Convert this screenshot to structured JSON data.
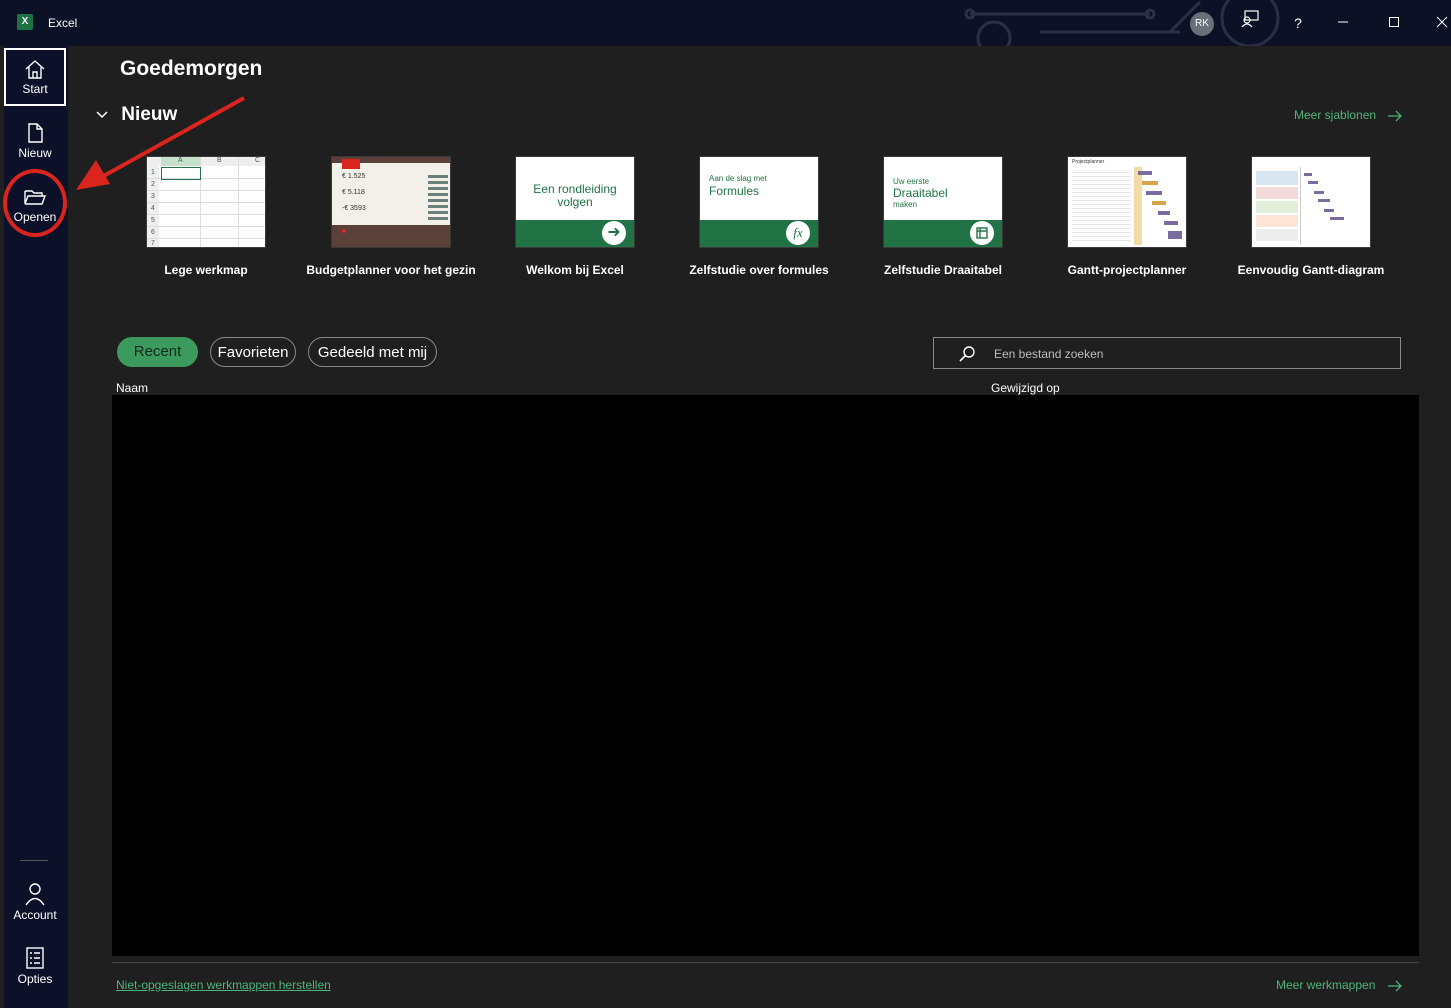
{
  "app": {
    "title": "Excel",
    "logo": "X",
    "avatar_initials": "RK"
  },
  "window_controls": {
    "help": "?"
  },
  "nav": {
    "start": "Start",
    "new": "Nieuw",
    "open": "Openen",
    "account": "Account",
    "options": "Opties"
  },
  "greeting": "Goedemorgen",
  "new_section": {
    "title": "Nieuw",
    "more_templates": "Meer sjablonen"
  },
  "templates": [
    {
      "label": "Lege werkmap",
      "cols": [
        "A",
        "B",
        "C"
      ],
      "rows": [
        "1",
        "2",
        "3",
        "4",
        "5",
        "6",
        "7"
      ]
    },
    {
      "label": "Budgetplanner voor het gezin",
      "values": [
        "€ 1.525",
        "€ 5.118",
        "-€ 3593"
      ]
    },
    {
      "label": "Welkom bij Excel",
      "text": "Een rondleiding volgen"
    },
    {
      "label": "Zelfstudie over formules",
      "small": "Aan de slag met",
      "text": "Formules",
      "badge": "fx"
    },
    {
      "label": "Zelfstudie Draaitabel",
      "small": "Uw eerste",
      "text": "Draaitabel",
      "sub": "maken"
    },
    {
      "label": "Gantt-projectplanner",
      "title": "Projectplanner"
    },
    {
      "label": "Eenvoudig Gantt-diagram"
    }
  ],
  "tabs": {
    "recent": "Recent",
    "favorites": "Favorieten",
    "shared": "Gedeeld met mij"
  },
  "search": {
    "placeholder": "Een bestand zoeken",
    "value": ""
  },
  "columns": {
    "name": "Naam",
    "modified": "Gewijzigd op"
  },
  "footer": {
    "recover": "Niet-opgeslagen werkmappen herstellen",
    "more_workbooks": "Meer werkmappen"
  },
  "colors": {
    "accent": "#4fb57a",
    "excel_green": "#217346",
    "annotation_red": "#d9251d"
  }
}
